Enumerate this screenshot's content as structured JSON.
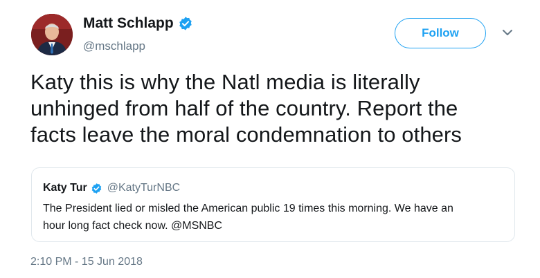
{
  "author": {
    "display_name": "Matt Schlapp",
    "handle": "@mschlapp",
    "verified": true,
    "avatar_icon": "avatar-photo"
  },
  "follow_button": {
    "label": "Follow",
    "color": "#1da1f2"
  },
  "menu": {
    "icon": "chevron-down-icon"
  },
  "tweet": {
    "lines": [
      "Katy this is why the Natl media is literally",
      "unhinged from half of the country. Report the",
      "facts leave the moral condemnation to others"
    ]
  },
  "quoted_tweet": {
    "display_name": "Katy Tur",
    "handle": "@KatyTurNBC",
    "verified": true,
    "lines": [
      "The President lied or misled the American public 19 times this morning. We have an",
      "hour long fact check now. @MSNBC"
    ]
  },
  "timestamp": "2:10 PM - 15 Jun 2018",
  "colors": {
    "accent": "#1da1f2",
    "secondary_text": "#657786",
    "border": "#e1e8ed"
  }
}
